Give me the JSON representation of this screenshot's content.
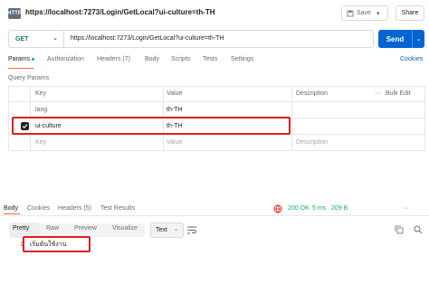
{
  "header": {
    "method_badge": "HTTP",
    "title": "https://localhost:7273/Login/GetLocal?ui-culture=th-TH",
    "save_label": "Save",
    "share_label": "Share"
  },
  "request": {
    "method": "GET",
    "url": "https://localhost:7273/Login/GetLocal?ui-culture=th-TH",
    "send_label": "Send"
  },
  "request_tabs": {
    "params": "Params",
    "authorization": "Authorization",
    "headers": "Headers (7)",
    "body": "Body",
    "scripts": "Scripts",
    "tests": "Tests",
    "settings": "Settings",
    "cookies": "Cookies"
  },
  "query_params": {
    "section_label": "Query Params",
    "columns": {
      "key": "Key",
      "value": "Value",
      "description": "Description",
      "bulk_edit": "Bulk Edit"
    },
    "rows": [
      {
        "checked": false,
        "key": "lang",
        "value": "th-TH",
        "description": ""
      },
      {
        "checked": true,
        "key": "ui-culture",
        "value": "th-TH",
        "description": ""
      }
    ],
    "new_row": {
      "key_placeholder": "Key",
      "value_placeholder": "Value",
      "description_placeholder": "Description"
    }
  },
  "response_tabs": {
    "body": "Body",
    "cookies": "Cookies",
    "headers": "Headers (5)",
    "test_results": "Test Results"
  },
  "response_status": {
    "status": "200 OK",
    "time": "5 ms",
    "size": "209 B"
  },
  "response_view": {
    "pretty": "Pretty",
    "raw": "Raw",
    "preview": "Preview",
    "visualize": "Visualize",
    "format": "Text"
  },
  "response_body": {
    "line_number": "1",
    "text": "เริ่มต้นใช้งาน"
  },
  "colors": {
    "accent": "#f26b3a",
    "send": "#0265d2",
    "status_ok": "#0cbb52",
    "highlight": "#e11d1d"
  }
}
